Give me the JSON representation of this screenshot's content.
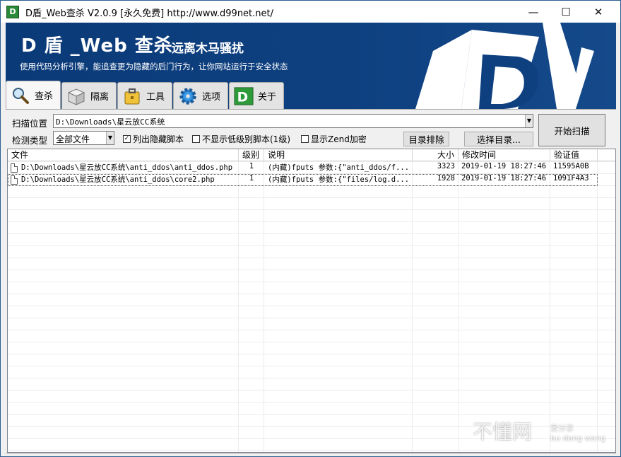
{
  "window": {
    "title": "D盾_Web查杀 V2.0.9 [永久免费] http://www.d99net.net/",
    "icon_letter": "D"
  },
  "banner": {
    "brand": "D 盾 _Web 查杀",
    "slogan": "远离木马骚扰",
    "subline": "使用代码分析引擎，能追查更为隐藏的后门行为，让你网站运行于安全状态"
  },
  "tabs": [
    {
      "label": "查杀",
      "icon": "magnifier-icon",
      "active": true
    },
    {
      "label": "隔离",
      "icon": "box-icon",
      "active": false
    },
    {
      "label": "工具",
      "icon": "toolbox-icon",
      "active": false
    },
    {
      "label": "选项",
      "icon": "gear-icon",
      "active": false
    },
    {
      "label": "关于",
      "icon": "d-logo-icon",
      "active": false
    }
  ],
  "toolbar": {
    "scan_location_label": "扫描位置",
    "scan_path": "D:\\Downloads\\星云放CC系统",
    "detect_type_label": "检测类型",
    "detect_type_value": "全部文件",
    "check_hidden_label": "列出隐藏脚本",
    "check_hidden_checked": true,
    "check_lowlevel_label": "不显示低级别脚本(1级)",
    "check_lowlevel_checked": false,
    "check_zend_label": "显示Zend加密",
    "check_zend_checked": false,
    "exclude_button": "目录排除",
    "choose_button": "选择目录...",
    "scan_button": "开始扫描"
  },
  "table": {
    "columns": [
      "文件",
      "级别",
      "说明",
      "大小",
      "修改时间",
      "验证值"
    ],
    "rows": [
      {
        "file": "D:\\Downloads\\星云放CC系统\\anti_ddos\\anti_ddos.php",
        "level": "1",
        "desc": "(内藏)fputs 参数:{\"anti_ddos/f...",
        "size": "3323",
        "mtime": "2019-01-19 18:27:46",
        "hash": "11595A0B"
      },
      {
        "file": "D:\\Downloads\\星云放CC系统\\anti_ddos\\core2.php",
        "level": "1",
        "desc": "(内藏)fputs 参数:{\"files/log.d...",
        "size": "1928",
        "mtime": "2019-01-19 18:27:46",
        "hash": "1091F4A3"
      }
    ]
  },
  "watermark": {
    "main": "不懂网",
    "sub1": "爱分享",
    "sub2": "bu dong wang"
  },
  "colors": {
    "banner_bg": "#0e4080",
    "desktop": "#1b6fae"
  }
}
